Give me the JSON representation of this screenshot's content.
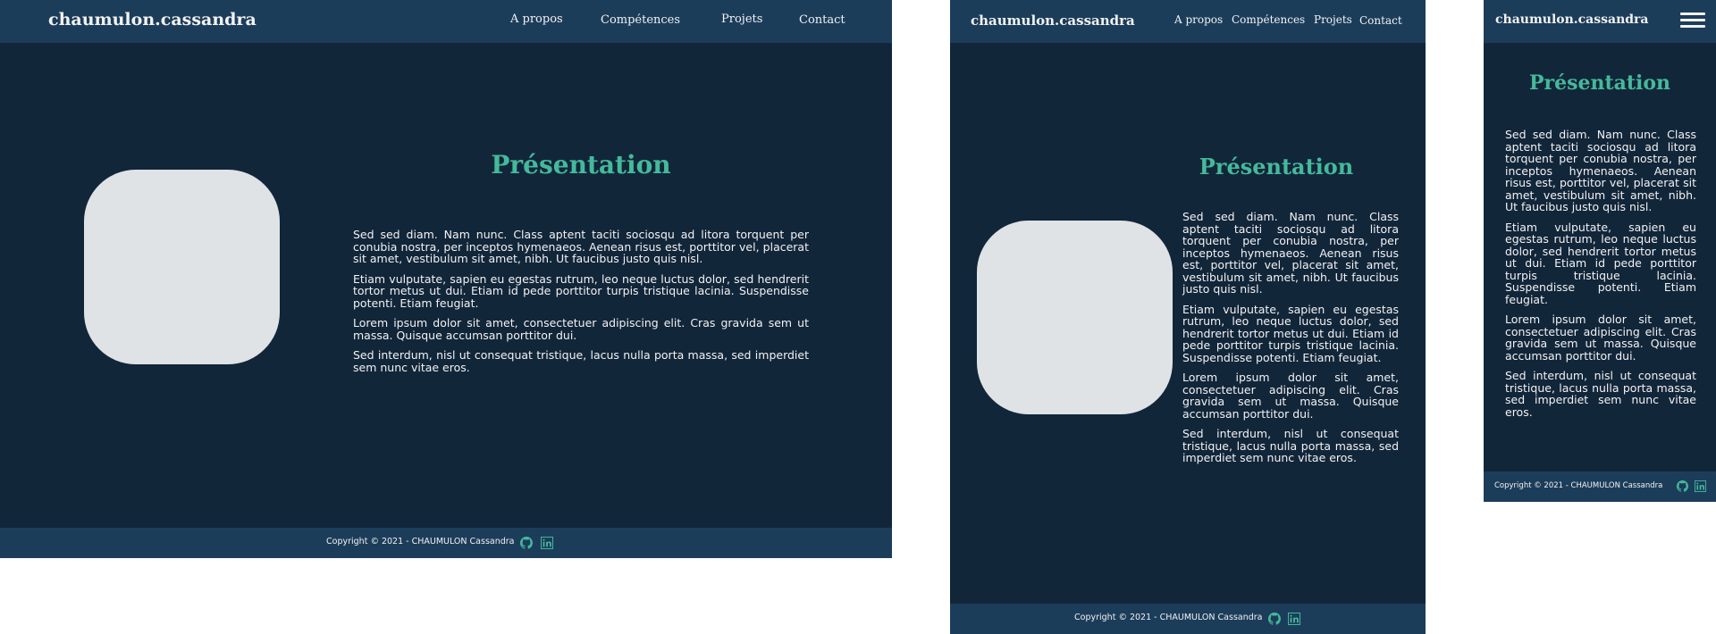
{
  "site": {
    "brand": "chaumulon.cassandra",
    "nav": [
      "A propos",
      "Compétences",
      "Projets",
      "Contact"
    ],
    "heading": "Présentation",
    "paragraphs": [
      "Sed sed diam. Nam nunc. Class aptent taciti sociosqu ad litora torquent per conubia nostra, per inceptos hymenaeos. Aenean risus est, porttitor vel, placerat sit amet, vestibulum sit amet, nibh. Ut faucibus justo quis nisl.",
      "Etiam vulputate, sapien eu egestas rutrum, leo neque luctus dolor, sed hendrerit tortor metus ut dui. Etiam id pede porttitor turpis tristique lacinia. Suspendisse potenti. Etiam feugiat.",
      "Lorem ipsum dolor sit amet, consectetuer adipiscing elit. Cras gravida sem ut massa. Quisque accumsan porttitor dui.",
      "Sed interdum, nisl ut consequat tristique, lacus nulla porta massa, sed imperdiet sem nunc vitae eros."
    ],
    "copyright": "Copyright © 2021 - CHAUMULON Cassandra",
    "icons": [
      "github-icon",
      "linkedin-icon",
      "hamburger-menu-icon"
    ]
  },
  "colors": {
    "page_bg": "#12263a",
    "header_bg": "#1c3d5a",
    "accent": "#45b99b",
    "text": "#f2f2f2",
    "photo_placeholder": "#dfe3e6"
  }
}
